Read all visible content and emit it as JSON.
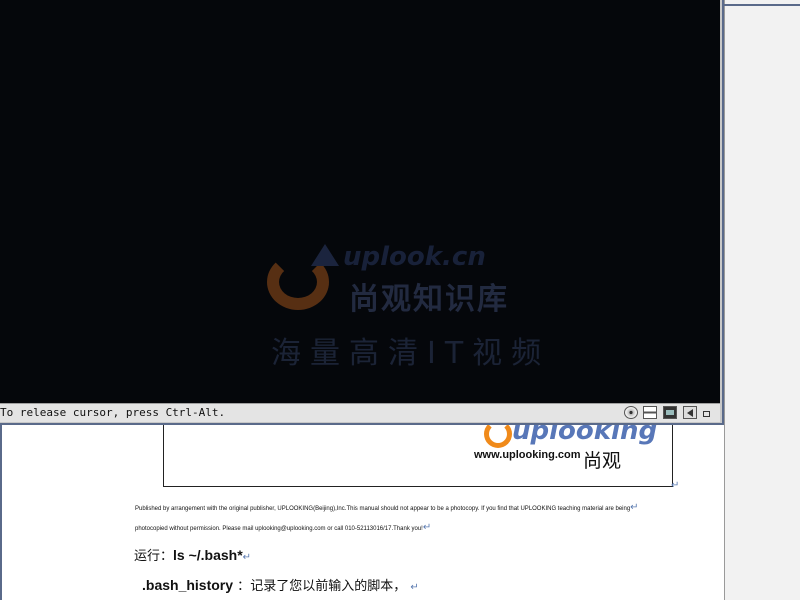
{
  "vm": {
    "watermark": {
      "url": "uplook.cn",
      "line1": "尚观知识库",
      "line2": "海量高清IT视频"
    },
    "status_text": "To release cursor, press Ctrl-Alt.",
    "tray_icons": [
      "cd-icon",
      "hard-disk-icon",
      "network-icon",
      "sound-icon",
      "window-icon"
    ]
  },
  "document": {
    "logo": {
      "brand": "uplooking",
      "url": "www.uplooking.com",
      "cn": "尚观"
    },
    "pub_line1": "Published by arrangement with the original publisher, UPLOOKING(Beijing),Inc.This manual should not appear to be a photocopy. If you find that UPLOOKING teaching material are being",
    "pub_line2": "photocopied without permission. Please mail uplooking@uplooking.com or call 010-52113016/17.Thank you!",
    "run_prefix": "运行：",
    "run_cmd": "ls ~/.bash*",
    "history_cmd": ".bash_history",
    "history_sep": "：",
    "history_desc": "记录了您以前输入的脚本，"
  }
}
